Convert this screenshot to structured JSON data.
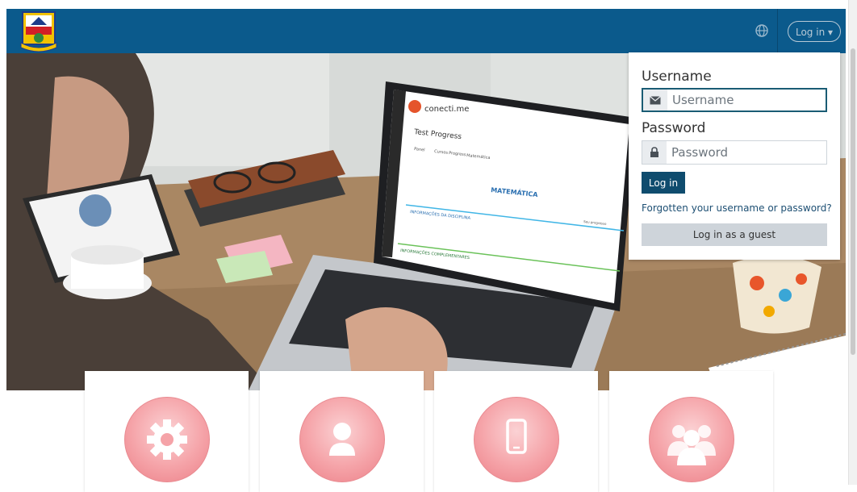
{
  "navbar": {
    "logo_icon": "institution-crest-icon",
    "language_icon": "globe-icon",
    "login_label": "Log in ▾",
    "bg_color": "#0b5a8c"
  },
  "hero": {
    "laptop_screen": {
      "brand": "conecti.me",
      "title": "Test Progress",
      "tabs": [
        "Panel",
        "Cursos",
        "Progress",
        "Matemática"
      ],
      "subject": "MATEMÁTICA",
      "section1": "INFORMAÇÕES DA DISCIPLINA",
      "section2": "INFORMAÇÕES COMPLEMENTARES",
      "progress_label": "Seu progresso"
    }
  },
  "login": {
    "username_label": "Username",
    "username_placeholder": "Username",
    "password_label": "Password",
    "password_placeholder": "Password",
    "login_button": "Log in",
    "forgot_link": "Forgotten your username or password?",
    "guest_button": "Log in as a guest",
    "accent_color": "#0f4c6e"
  },
  "features": {
    "cards": [
      {
        "icon": "gear-icon"
      },
      {
        "icon": "user-icon"
      },
      {
        "icon": "mobile-icon"
      },
      {
        "icon": "group-icon"
      }
    ],
    "circle_color": "#f5a3a8"
  }
}
